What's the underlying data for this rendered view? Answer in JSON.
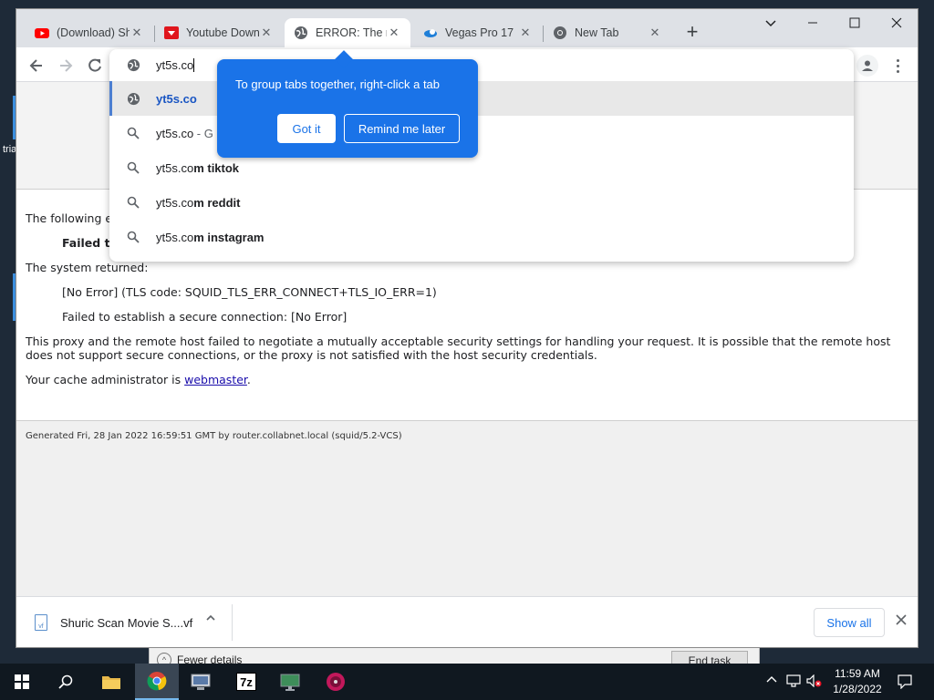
{
  "desktop": {
    "label": "tria"
  },
  "taskmgr": {
    "fewer_details": "Fewer details",
    "end_task": "End task"
  },
  "tabs": [
    {
      "title": "(Download) Sh",
      "icon": "youtube-icon"
    },
    {
      "title": "Youtube Down",
      "icon": "download-heart-icon"
    },
    {
      "title": "ERROR: The re",
      "icon": "globe-icon",
      "active": true
    },
    {
      "title": "Vegas Pro 17",
      "icon": "vegas-icon"
    },
    {
      "title": "New Tab",
      "icon": "chrome-icon"
    }
  ],
  "omnibox": {
    "value": "yt5s.co",
    "suggestions": [
      {
        "plain": "",
        "bold": "yt5s.co",
        "suffix": "",
        "icon": "globe-icon"
      },
      {
        "plain": "yt5s.co",
        "bold": "",
        "suffix": " - G",
        "icon": "search-icon"
      },
      {
        "plain": "yt5s.co",
        "bold": "m tiktok",
        "suffix": "",
        "icon": "search-icon"
      },
      {
        "plain": "yt5s.co",
        "bold": "m reddit",
        "suffix": "",
        "icon": "search-icon"
      },
      {
        "plain": "yt5s.co",
        "bold": "m instagram",
        "suffix": "",
        "icon": "search-icon"
      }
    ]
  },
  "promo": {
    "message": "To group tabs together, right-click a tab",
    "got_it": "Got it",
    "remind_later": "Remind me later"
  },
  "page": {
    "following": "The following e",
    "failed_to": "Failed to",
    "system_returned": "The system returned:",
    "no_error": "[No Error] (TLS code: SQUID_TLS_ERR_CONNECT+TLS_IO_ERR=1)",
    "failed_secure": "Failed to establish a secure connection: [No Error]",
    "explanation": "This proxy and the remote host failed to negotiate a mutually acceptable security settings for handling your request. It is possible that the remote host does not support secure connections, or the proxy is not satisfied with the host security credentials.",
    "cache_admin_prefix": "Your cache administrator is ",
    "cache_admin_link": "webmaster",
    "cache_admin_suffix": ".",
    "generated": "Generated Fri, 28 Jan 2022 16:59:51 GMT by router.collabnet.local (squid/5.2-VCS)"
  },
  "download_bar": {
    "file_name": "Shuric Scan Movie S....vf",
    "file_icon_label": "vf",
    "show_all": "Show all"
  },
  "taskbar": {
    "time": "11:59 AM",
    "date": "1/28/2022",
    "sevenzip_label": "7z"
  },
  "colors": {
    "accent": "#1a73e8",
    "selection_bar": "#4d7fd1",
    "taskbar": "#101820"
  }
}
